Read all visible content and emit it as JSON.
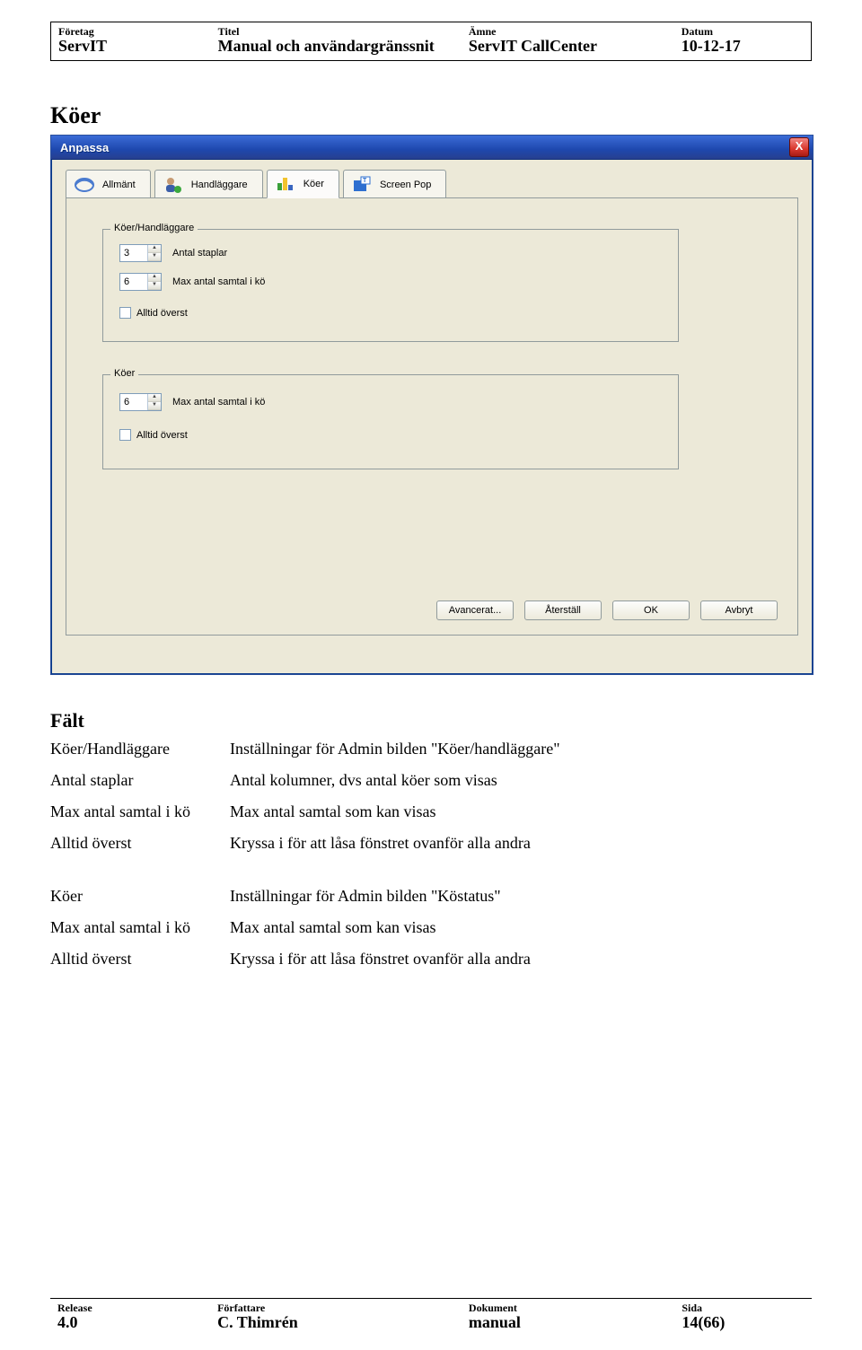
{
  "header": {
    "c1_label": "Företag",
    "c1_val": "ServIT",
    "c2_label": "Titel",
    "c2_val": "Manual och användargränssnit",
    "c3_label": "Ämne",
    "c3_val": "ServIT CallCenter",
    "c4_label": "Datum",
    "c4_val": "10-12-17"
  },
  "section_title": "Köer",
  "dialog": {
    "title": "Anpassa",
    "close_glyph": "X",
    "tabs": {
      "general": "Allmänt",
      "handlers": "Handläggare",
      "queues": "Köer",
      "screenpop": "Screen Pop"
    },
    "group1": {
      "legend": "Köer/Handläggare",
      "spin1_val": "3",
      "spin1_label": "Antal staplar",
      "spin2_val": "6",
      "spin2_label": "Max antal samtal i kö",
      "chk_label": "Alltid överst"
    },
    "group2": {
      "legend": "Köer",
      "spin_val": "6",
      "spin_label": "Max antal samtal i kö",
      "chk_label": "Alltid överst"
    },
    "buttons": {
      "adv": "Avancerat...",
      "reset": "Återställ",
      "ok": "OK",
      "cancel": "Avbryt"
    }
  },
  "falt_heading": "Fält",
  "table1": {
    "t1": "Köer/Handläggare",
    "d1": "Inställningar för Admin bilden \"Köer/handläggare\"",
    "t2": "Antal staplar",
    "d2": "Antal kolumner, dvs antal köer som visas",
    "t3": "Max antal samtal i kö",
    "d3": "Max antal samtal som kan visas",
    "t4": "Alltid överst",
    "d4": "Kryssa i för att låsa fönstret ovanför alla andra"
  },
  "table2": {
    "t1": "Köer",
    "d1": "Inställningar för Admin bilden \"Köstatus\"",
    "t2": "Max antal samtal i kö",
    "d2": "Max antal samtal som kan visas",
    "t3": "Alltid överst",
    "d3": "Kryssa i för att låsa fönstret ovanför alla andra"
  },
  "footer": {
    "c1_label": "Release",
    "c1_val": "4.0",
    "c2_label": "Författare",
    "c2_val": "C. Thimrén",
    "c3_label": "Dokument",
    "c3_val": "manual",
    "c4_label": "Sida",
    "c4_val": "14(66)"
  }
}
